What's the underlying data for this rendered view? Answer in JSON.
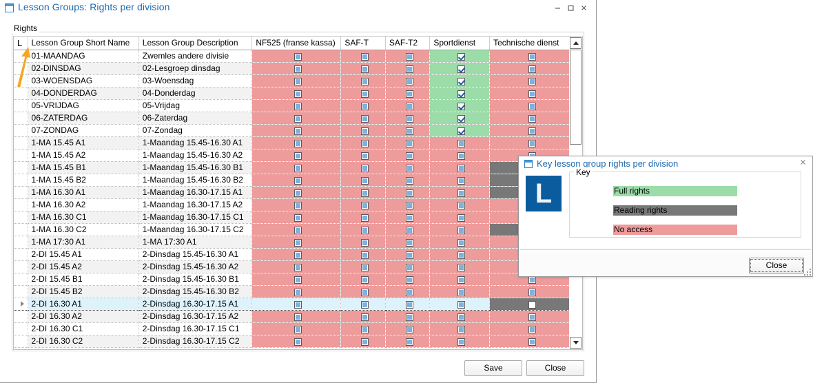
{
  "window": {
    "title": "Lesson Groups: Rights per division",
    "icon": "window-icon",
    "minimize": "–",
    "maximize": "□",
    "close": "✕"
  },
  "groupbox": {
    "label": "Rights"
  },
  "grid": {
    "corner_label": "L",
    "columns": [
      "Lesson Group Short Name",
      "Lesson Group Description",
      "NF525 (franse kassa)",
      "SAF-T",
      "SAF-T2",
      "Sportdienst",
      "Technische dienst"
    ],
    "rows": [
      {
        "name": "01-MAANDAG",
        "desc": "Zwemles andere divisie",
        "perms": [
          "none",
          "none",
          "none",
          "full",
          "none"
        ]
      },
      {
        "name": "02-DINSDAG",
        "desc": "02-Lesgroep dinsdag",
        "perms": [
          "none",
          "none",
          "none",
          "full",
          "none"
        ]
      },
      {
        "name": "03-WOENSDAG",
        "desc": "03-Woensdag",
        "perms": [
          "none",
          "none",
          "none",
          "full",
          "none"
        ]
      },
      {
        "name": "04-DONDERDAG",
        "desc": "04-Donderdag",
        "perms": [
          "none",
          "none",
          "none",
          "full",
          "none"
        ]
      },
      {
        "name": "05-VRIJDAG",
        "desc": "05-Vrijdag",
        "perms": [
          "none",
          "none",
          "none",
          "full",
          "none"
        ]
      },
      {
        "name": "06-ZATERDAG",
        "desc": "06-Zaterdag",
        "perms": [
          "none",
          "none",
          "none",
          "full",
          "none"
        ]
      },
      {
        "name": "07-ZONDAG",
        "desc": "07-Zondag",
        "perms": [
          "none",
          "none",
          "none",
          "full",
          "none"
        ]
      },
      {
        "name": "1-MA 15.45 A1",
        "desc": "1-Maandag 15.45-16.30 A1",
        "perms": [
          "none",
          "none",
          "none",
          "none",
          "none"
        ]
      },
      {
        "name": "1-MA 15.45 A2",
        "desc": "1-Maandag 15.45-16.30 A2",
        "perms": [
          "none",
          "none",
          "none",
          "none",
          "none"
        ]
      },
      {
        "name": "1-MA 15.45 B1",
        "desc": "1-Maandag 15.45-16.30 B1",
        "perms": [
          "none",
          "none",
          "none",
          "none",
          "read"
        ]
      },
      {
        "name": "1-MA 15.45 B2",
        "desc": "1-Maandag 15.45-16.30 B2",
        "perms": [
          "none",
          "none",
          "none",
          "none",
          "read"
        ]
      },
      {
        "name": "1-MA 16.30 A1",
        "desc": "1-Maandag 16.30-17.15 A1",
        "perms": [
          "none",
          "none",
          "none",
          "none",
          "read"
        ]
      },
      {
        "name": "1-MA 16.30 A2",
        "desc": "1-Maandag 16.30-17.15 A2",
        "perms": [
          "none",
          "none",
          "none",
          "none",
          "none"
        ]
      },
      {
        "name": "1-MA 16.30 C1",
        "desc": "1-Maandag 16.30-17.15 C1",
        "perms": [
          "none",
          "none",
          "none",
          "none",
          "none"
        ]
      },
      {
        "name": "1-MA 16.30 C2",
        "desc": "1-Maandag 16.30-17.15 C2",
        "perms": [
          "none",
          "none",
          "none",
          "none",
          "read"
        ]
      },
      {
        "name": "1-MA 17:30 A1",
        "desc": "1-MA 17:30 A1",
        "perms": [
          "none",
          "none",
          "none",
          "none",
          "none"
        ]
      },
      {
        "name": "2-DI 15.45 A1",
        "desc": "2-Dinsdag 15.45-16.30 A1",
        "perms": [
          "none",
          "none",
          "none",
          "none",
          "none"
        ]
      },
      {
        "name": "2-DI 15.45 A2",
        "desc": "2-Dinsdag 15.45-16.30 A2",
        "perms": [
          "none",
          "none",
          "none",
          "none",
          "none"
        ]
      },
      {
        "name": "2-DI 15.45 B1",
        "desc": "2-Dinsdag 15.45-16.30 B1",
        "perms": [
          "none",
          "none",
          "none",
          "none",
          "none"
        ]
      },
      {
        "name": "2-DI 15.45 B2",
        "desc": "2-Dinsdag 15.45-16.30 B2",
        "perms": [
          "none",
          "none",
          "none",
          "none",
          "none"
        ]
      },
      {
        "name": "2-DI 16.30 A1",
        "desc": "2-Dinsdag 16.30-17.15 A1",
        "perms": [
          "sel",
          "sel",
          "sel",
          "sel",
          "read"
        ],
        "selected": true
      },
      {
        "name": "2-DI 16.30 A2",
        "desc": "2-Dinsdag 16.30-17.15 A2",
        "perms": [
          "none",
          "none",
          "none",
          "none",
          "none"
        ]
      },
      {
        "name": "2-DI 16.30 C1",
        "desc": "2-Dinsdag 16.30-17.15 C1",
        "perms": [
          "none",
          "none",
          "none",
          "none",
          "none"
        ]
      },
      {
        "name": "2-DI 16.30 C2",
        "desc": "2-Dinsdag 16.30-17.15 C2",
        "perms": [
          "none",
          "none",
          "none",
          "none",
          "none"
        ]
      }
    ]
  },
  "scrollbar": {
    "up": "scroll-up",
    "down": "scroll-down"
  },
  "footer": {
    "save_label": "Save",
    "close_label": "Close"
  },
  "key_dialog": {
    "title": "Key lesson group rights per division",
    "close_x": "✕",
    "logo_letter": "L",
    "group_label": "Key",
    "entries": [
      {
        "label": "Full rights",
        "color": "#9cdca8"
      },
      {
        "label": "Reading rights",
        "color": "#787878"
      },
      {
        "label": "No access",
        "color": "#ee9b9b"
      }
    ],
    "close_label": "Close"
  },
  "colors": {
    "full_rights": "#9cdca8",
    "reading_rights": "#787878",
    "no_access": "#ee9b9b",
    "selected_row": "#ddf2fb",
    "brand_blue": "#0f5c9e",
    "title_text": "#1c6ab0",
    "annotation_arrow": "#f5a623"
  }
}
